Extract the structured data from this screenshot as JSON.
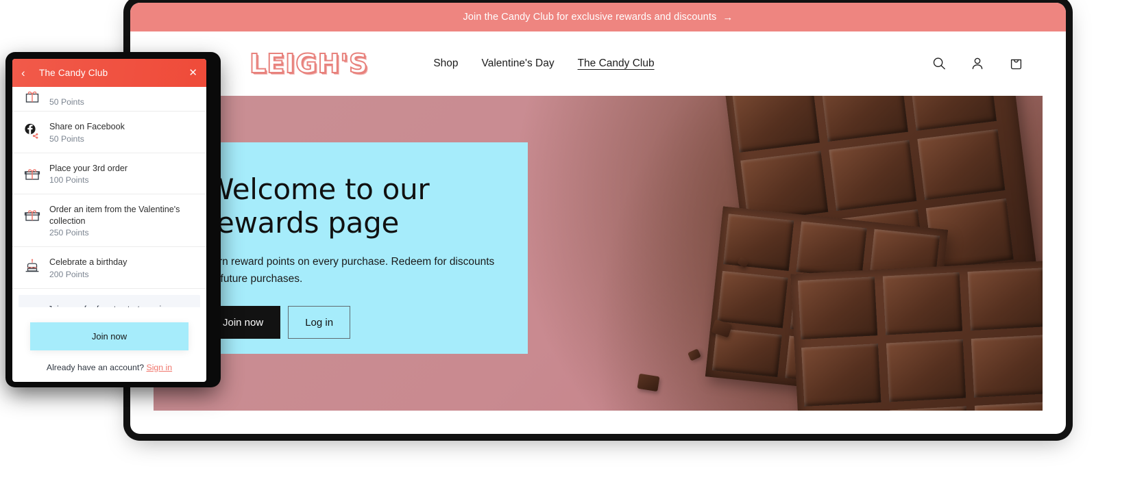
{
  "announcement": {
    "text": "Join the Candy Club for exclusive rewards and discounts",
    "arrow": "→",
    "background": "#ee8580"
  },
  "header": {
    "brand": "LEIGH'S",
    "nav": [
      {
        "label": "Shop",
        "active": false
      },
      {
        "label": "Valentine's Day",
        "active": false
      },
      {
        "label": "The Candy Club",
        "active": true
      }
    ],
    "actions": [
      {
        "icon": "search-icon",
        "label": "Search"
      },
      {
        "icon": "account-icon",
        "label": "Log in"
      },
      {
        "icon": "cart-icon",
        "label": "Cart"
      }
    ]
  },
  "hero": {
    "title": "Welcome to our rewards page",
    "subtitle": "Earn reward points on every purchase. Redeem for discounts on future purchases.",
    "primary_button": "Join now",
    "secondary_button": "Log in",
    "card_background": "#a6ecfb"
  },
  "widget": {
    "title": "The Candy Club",
    "back_icon": "‹",
    "close_icon": "✕",
    "header_background": "#ef4b39",
    "earn_rows": [
      {
        "icon": "clipped-icon",
        "title": "",
        "points": "50 Points",
        "clipped": true
      },
      {
        "icon": "facebook-share-icon",
        "title": "Share on Facebook",
        "points": "50 Points",
        "clipped": false
      },
      {
        "icon": "gift-icon",
        "title": "Place your 3rd order",
        "points": "100 Points",
        "clipped": false
      },
      {
        "icon": "gift-icon",
        "title": "Order an item from the Valentine's collection",
        "points": "250 Points",
        "clipped": false
      },
      {
        "icon": "birthday-cake-icon",
        "title": "Celebrate a birthday",
        "points": "200 Points",
        "clipped": false
      }
    ],
    "cta_banner": "Join now for free to start earning",
    "join_button": "Join now",
    "signin_prefix": "Already have an account?",
    "signin_link": "Sign in"
  }
}
